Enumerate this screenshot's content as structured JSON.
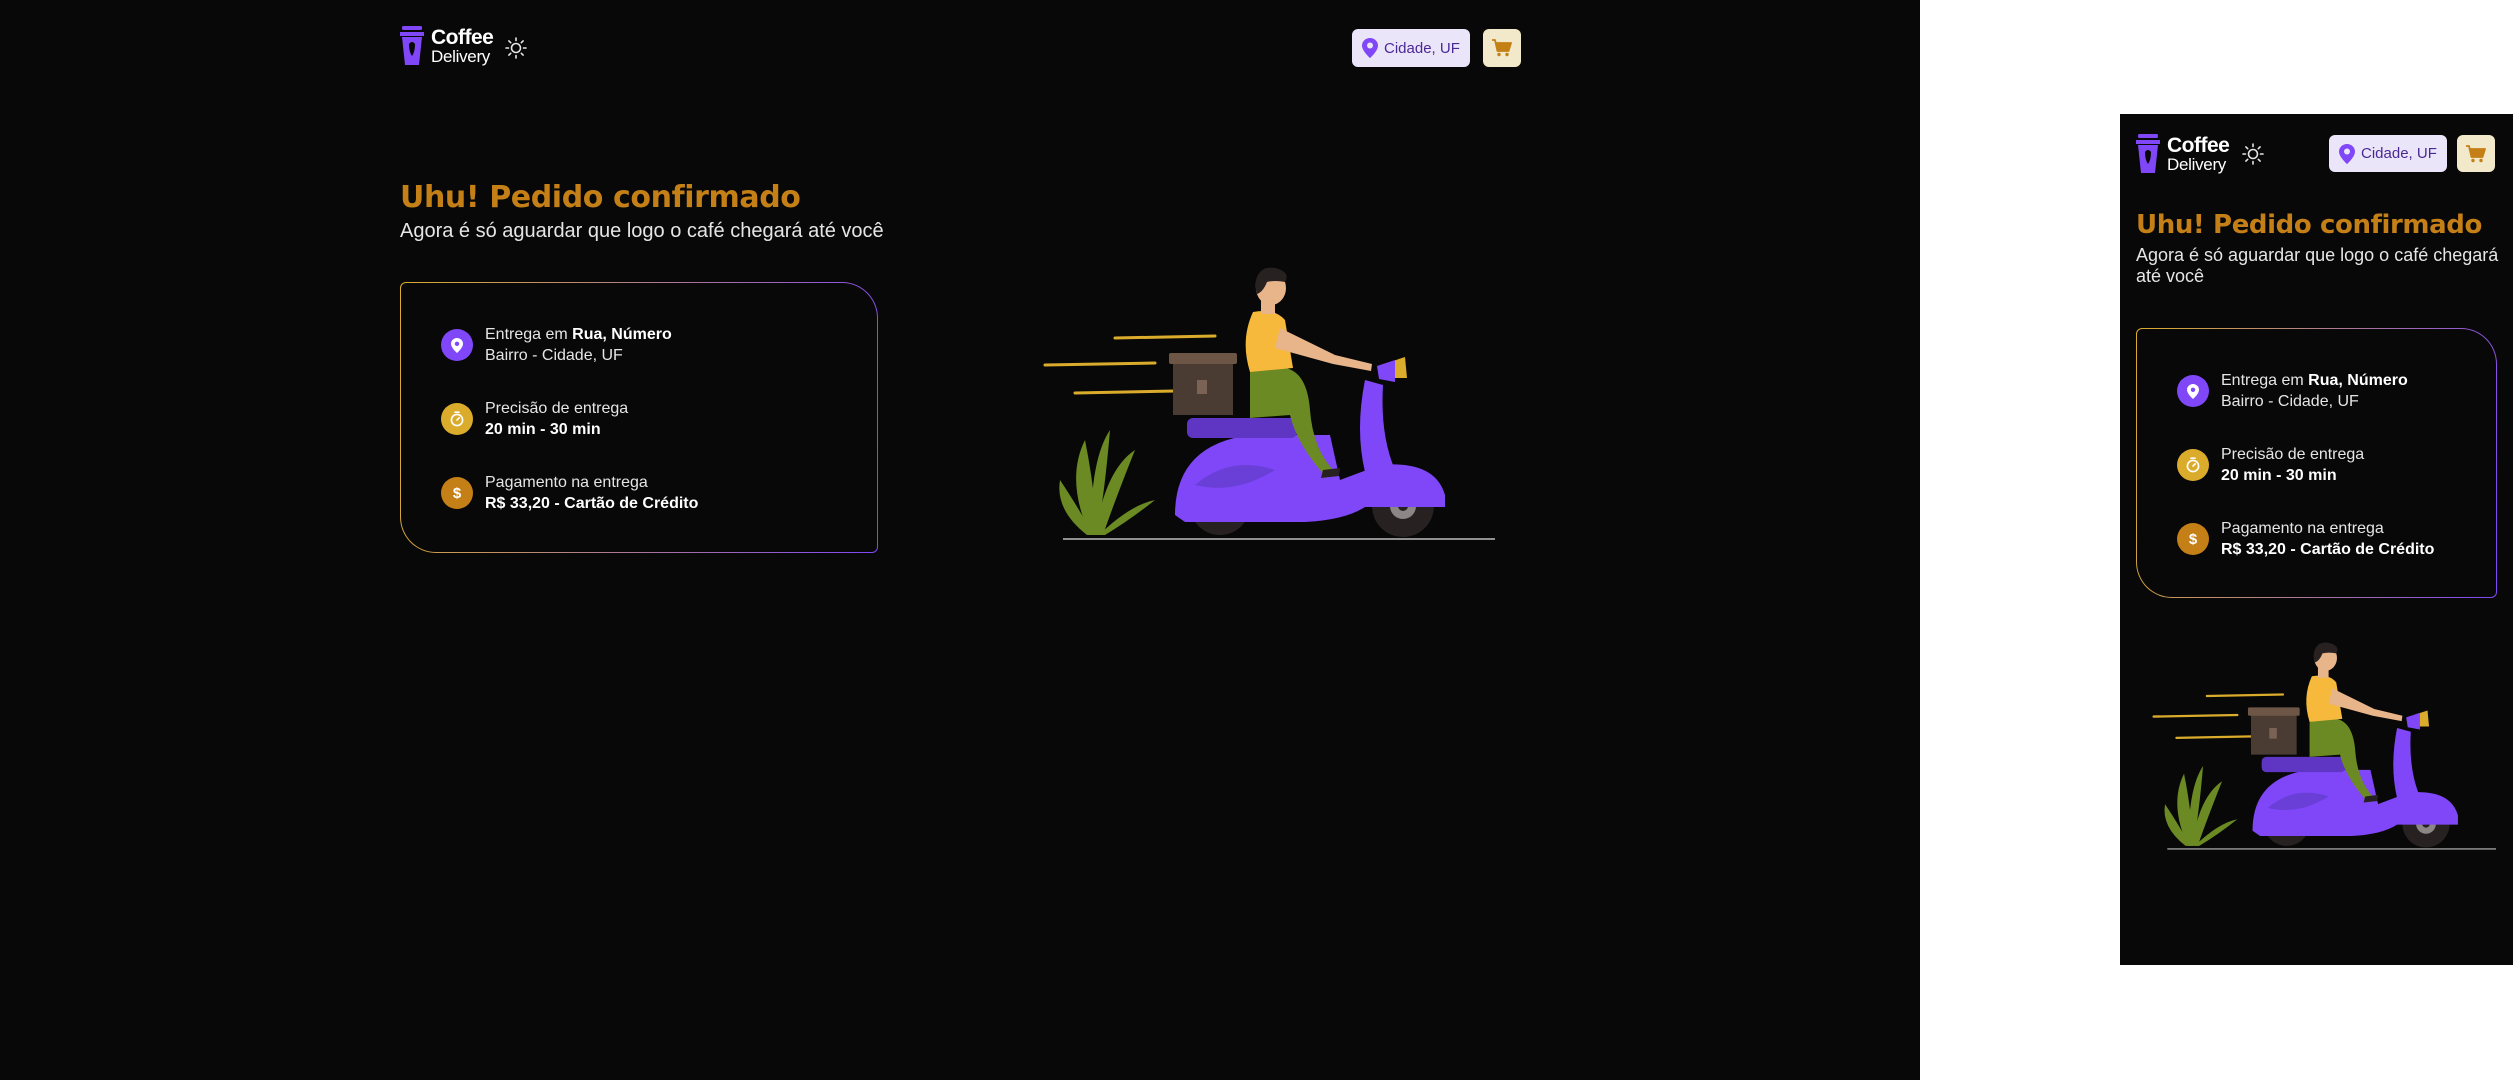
{
  "brand": {
    "line1": "Coffee",
    "line2": "Delivery"
  },
  "header": {
    "location_label": "Cidade, UF",
    "theme_icon": "sun-icon",
    "cart_icon": "shopping-cart-icon",
    "location_icon": "map-pin-icon"
  },
  "page": {
    "title": "Uhu! Pedido confirmado",
    "subtitle": "Agora é só aguardar que logo o café chegará até você"
  },
  "order": {
    "address_prefix": "Entrega em",
    "address_street": "Rua, Número",
    "address_line2": "Bairro - Cidade, UF",
    "time_label": "Precisão de entrega",
    "time_value": "20 min - 30 min",
    "payment_label": "Pagamento na entrega",
    "payment_value": "R$ 33,20 - Cartão de Crédito"
  },
  "colors": {
    "accent_purple": "#8047f8",
    "accent_yellow": "#dbac2c",
    "accent_yellow_dark": "#c47f17",
    "background": "#080808"
  },
  "icons": {
    "address": "map-pin-icon",
    "time": "timer-icon",
    "payment": "dollar-icon"
  },
  "illustration": "delivery-scooter-illustration"
}
